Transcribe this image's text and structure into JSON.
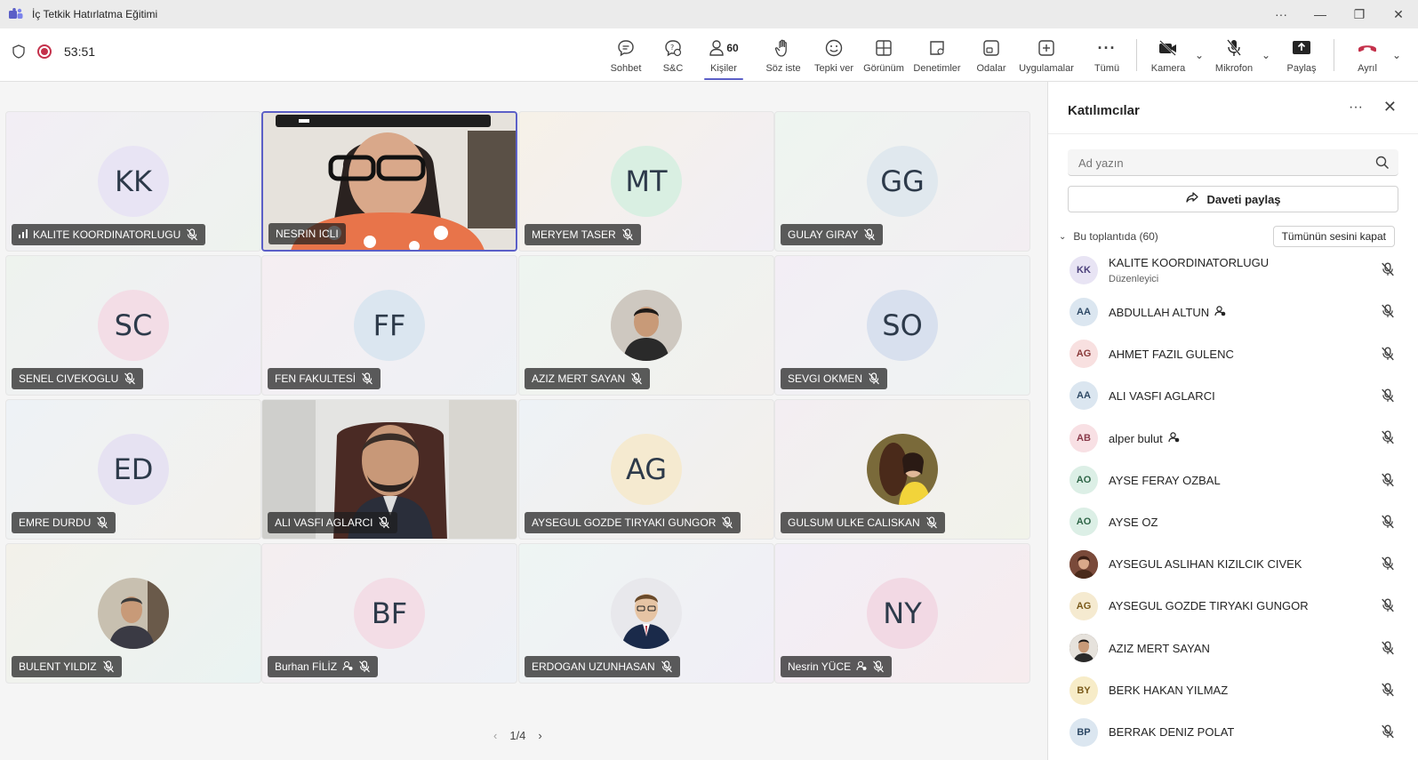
{
  "window": {
    "title": "İç Tetkik Hatırlatma Eğitimi"
  },
  "toolbar": {
    "timer": "53:51",
    "people_count": "60",
    "buttons": {
      "chat": "Sohbet",
      "qa": "S&C",
      "people": "Kişiler",
      "raise": "Söz iste",
      "react": "Tepki ver",
      "view": "Görünüm",
      "controls": "Denetimler",
      "rooms": "Odalar",
      "apps": "Uygulamalar",
      "more": "Tümü",
      "camera": "Kamera",
      "mic": "Mikrofon",
      "share": "Paylaş",
      "leave": "Ayrıl"
    }
  },
  "stage": {
    "tiles": [
      {
        "name": "KALITE KOORDINATORLUGU",
        "initials": "KK",
        "avatar_bg": "#e8e4f4",
        "bg": "linear-gradient(135deg,#f2eef5,#eef3ee)"
      },
      {
        "name": "NESRIN ICLI",
        "initials": "",
        "avatar_bg": "",
        "bg": ""
      },
      {
        "name": "MERYEM TASER",
        "initials": "MT",
        "avatar_bg": "#d9efe2",
        "bg": "linear-gradient(135deg,#f6f1e8,#f1eef4)"
      },
      {
        "name": "GULAY GIRAY",
        "initials": "GG",
        "avatar_bg": "#e0e8ee",
        "bg": "linear-gradient(135deg,#eef5f0,#f3eef2)"
      },
      {
        "name": "SENEL CIVEKOGLU",
        "initials": "SC",
        "avatar_bg": "#f3dde6",
        "bg": "linear-gradient(135deg,#eef3ee,#f1eef6)"
      },
      {
        "name": "FEN FAKULTESİ",
        "initials": "FF",
        "avatar_bg": "#dbe6f0",
        "bg": "linear-gradient(135deg,#f5eef2,#eef1f5)"
      },
      {
        "name": "AZIZ MERT SAYAN",
        "initials": "",
        "avatar_bg": "",
        "bg": "linear-gradient(135deg,#eef5f0,#f2f0ee)"
      },
      {
        "name": "SEVGI OKMEN",
        "initials": "SO",
        "avatar_bg": "#d8e0ee",
        "bg": "linear-gradient(135deg,#f3eef5,#eef4f2)"
      },
      {
        "name": "EMRE DURDU",
        "initials": "ED",
        "avatar_bg": "#e6e2f2",
        "bg": "linear-gradient(135deg,#eef2f6,#f3f1ec)"
      },
      {
        "name": "ALI VASFI AGLARCI",
        "initials": "",
        "avatar_bg": "",
        "bg": ""
      },
      {
        "name": "AYSEGUL GOZDE TIRYAKI GUNGOR",
        "initials": "AG",
        "avatar_bg": "#f5ead0",
        "bg": "linear-gradient(135deg,#eef2f6,#f3efea)"
      },
      {
        "name": "GULSUM ULKE CALISKAN",
        "initials": "",
        "avatar_bg": "",
        "bg": "linear-gradient(135deg,#f3eef2,#f1f3ea)"
      },
      {
        "name": "BULENT YILDIZ",
        "initials": "",
        "avatar_bg": "",
        "bg": "linear-gradient(135deg,#f3f1ea,#eaf3f2)"
      },
      {
        "name": "Burhan FİLİZ",
        "initials": "BF",
        "avatar_bg": "#f3dde6",
        "bg": "linear-gradient(135deg,#f4eef0,#eef1f6)"
      },
      {
        "name": "ERDOGAN UZUNHASAN",
        "initials": "",
        "avatar_bg": "",
        "bg": "linear-gradient(135deg,#eef5f3,#f1eef6)"
      },
      {
        "name": "Nesrin YÜCE",
        "initials": "NY",
        "avatar_bg": "#f2d9e4",
        "bg": "linear-gradient(135deg,#f2eef6,#f6ecee)"
      }
    ],
    "pager": "1/4"
  },
  "panel": {
    "title": "Katılımcılar",
    "search_placeholder": "Ad yazın",
    "share_invite": "Daveti paylaş",
    "section_label": "Bu toplantıda (60)",
    "mute_all": "Tümünün sesini kapat",
    "participants": [
      {
        "initials": "KK",
        "name": "KALITE KOORDINATORLUGU",
        "role": "Düzenleyici",
        "bg": "#e8e4f4",
        "fg": "#4a3f7a",
        "photo": false
      },
      {
        "initials": "AA",
        "name": "ABDULLAH ALTUN",
        "role": "",
        "bg": "#dbe6f0",
        "fg": "#2f4a66",
        "photo": false,
        "badge": true
      },
      {
        "initials": "AG",
        "name": "AHMET FAZIL GULENC",
        "role": "",
        "bg": "#f8e0e0",
        "fg": "#8a3a3a",
        "photo": false
      },
      {
        "initials": "AA",
        "name": "ALI VASFI AGLARCI",
        "role": "",
        "bg": "#dbe6f0",
        "fg": "#2f4a66",
        "photo": false
      },
      {
        "initials": "AB",
        "name": "alper bulut",
        "role": "",
        "bg": "#f8e0e4",
        "fg": "#8a3a4a",
        "photo": false,
        "badge": true
      },
      {
        "initials": "AO",
        "name": "AYSE FERAY OZBAL",
        "role": "",
        "bg": "#dcefe6",
        "fg": "#2f6648",
        "photo": false
      },
      {
        "initials": "AO",
        "name": "AYSE OZ",
        "role": "",
        "bg": "#dcefe6",
        "fg": "#2f6648",
        "photo": false
      },
      {
        "initials": "",
        "name": "AYSEGUL ASLIHAN KIZILCIK CIVEK",
        "role": "",
        "bg": "#7a4a3a",
        "fg": "#fff",
        "photo": true
      },
      {
        "initials": "AG",
        "name": "AYSEGUL GOZDE TIRYAKI GUNGOR",
        "role": "",
        "bg": "#f5ead0",
        "fg": "#7a5a1a",
        "photo": false
      },
      {
        "initials": "",
        "name": "AZIZ MERT SAYAN",
        "role": "",
        "bg": "#5a4a40",
        "fg": "#fff",
        "photo": true
      },
      {
        "initials": "BY",
        "name": "BERK HAKAN YILMAZ",
        "role": "",
        "bg": "#f7ecc8",
        "fg": "#7a5a1a",
        "photo": false
      },
      {
        "initials": "BP",
        "name": "BERRAK DENIZ POLAT",
        "role": "",
        "bg": "#dbe6f0",
        "fg": "#2f4a66",
        "photo": false
      }
    ]
  }
}
